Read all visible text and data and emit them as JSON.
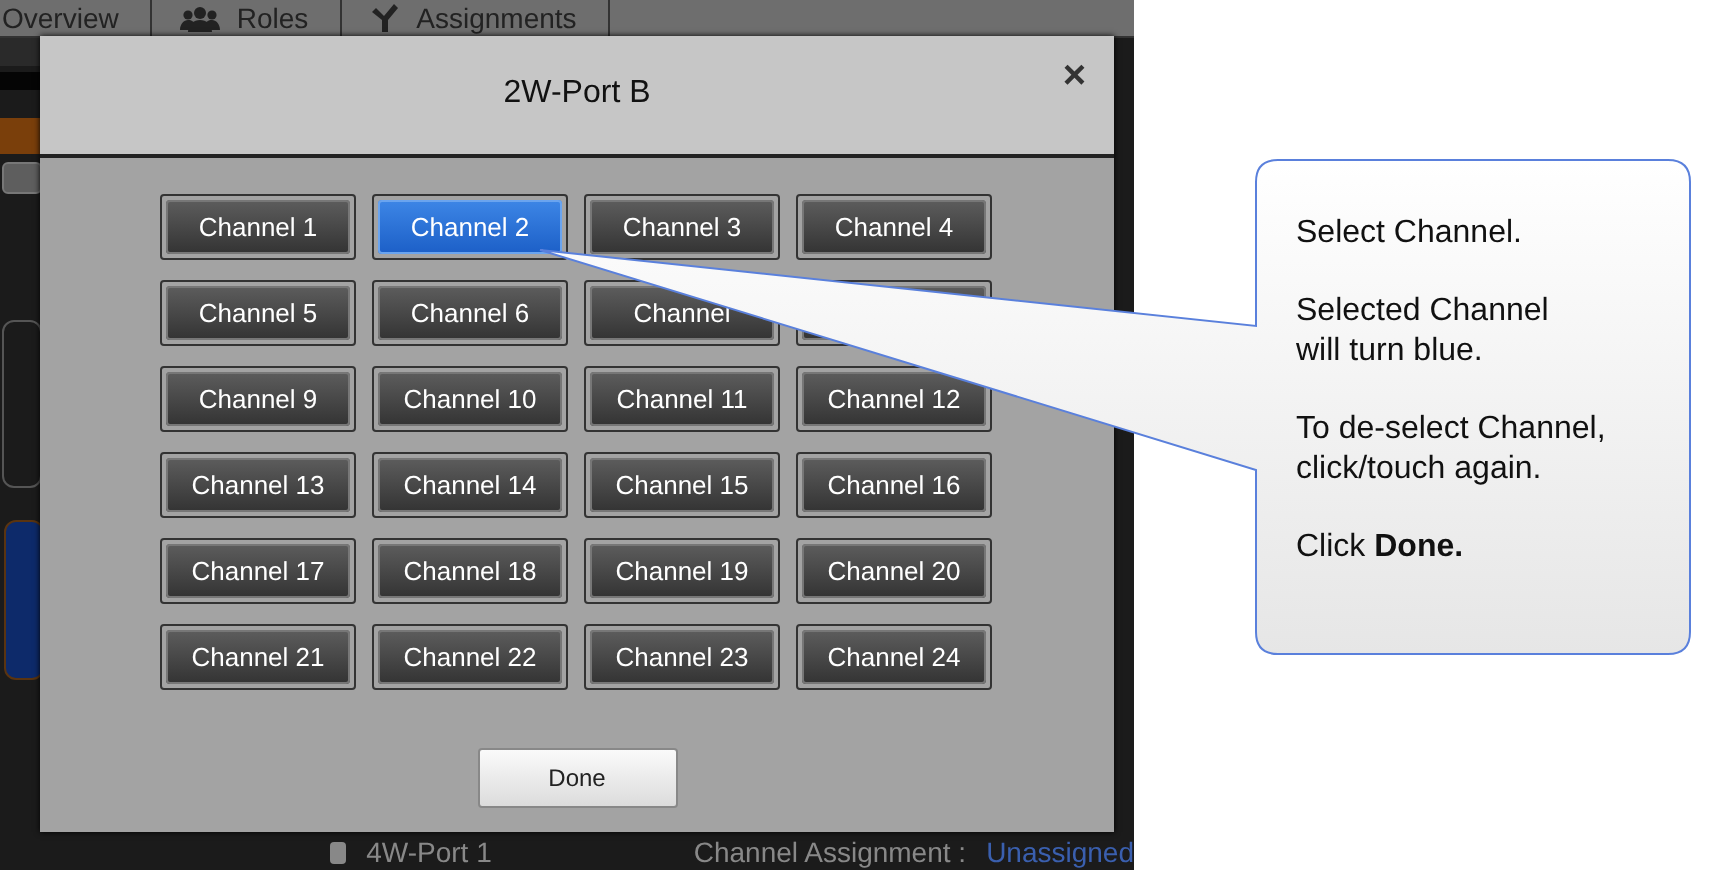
{
  "app": {
    "tabs": [
      {
        "label": "Overview"
      },
      {
        "label": "Roles"
      },
      {
        "label": "Assignments"
      }
    ],
    "port": {
      "label": "4W-Port 1",
      "checked": false
    },
    "assignment_label": "Channel Assignment :",
    "assignment_value": "Unassigned"
  },
  "dialog": {
    "title": "2W-Port B",
    "close": "×",
    "channels": [
      {
        "label": "Channel 1",
        "selected": false
      },
      {
        "label": "Channel 2",
        "selected": true
      },
      {
        "label": "Channel 3",
        "selected": false
      },
      {
        "label": "Channel 4",
        "selected": false
      },
      {
        "label": "Channel 5",
        "selected": false
      },
      {
        "label": "Channel 6",
        "selected": false
      },
      {
        "label": "Channel",
        "selected": false
      },
      {
        "selected": false
      },
      {
        "label": "Channel 9",
        "selected": false
      },
      {
        "label": "Channel 10",
        "selected": false
      },
      {
        "label": "Channel 11",
        "selected": false
      },
      {
        "label": "Channel 12",
        "selected": false
      },
      {
        "label": "Channel 13",
        "selected": false
      },
      {
        "label": "Channel 14",
        "selected": false
      },
      {
        "label": "Channel 15",
        "selected": false
      },
      {
        "label": "Channel 16",
        "selected": false
      },
      {
        "label": "Channel 17",
        "selected": false
      },
      {
        "label": "Channel 18",
        "selected": false
      },
      {
        "label": "Channel 19",
        "selected": false
      },
      {
        "label": "Channel 20",
        "selected": false
      },
      {
        "label": "Channel 21",
        "selected": false
      },
      {
        "label": "Channel 22",
        "selected": false
      },
      {
        "label": "Channel 23",
        "selected": false
      },
      {
        "label": "Channel 24",
        "selected": false
      }
    ],
    "done": "Done"
  },
  "callout": {
    "paragraphs": [
      [
        "Select Channel."
      ],
      [
        "Selected Channel",
        "will turn blue."
      ],
      [
        "To de-select Channel,",
        "click/touch again."
      ],
      [
        "Click **Done.**"
      ]
    ]
  }
}
